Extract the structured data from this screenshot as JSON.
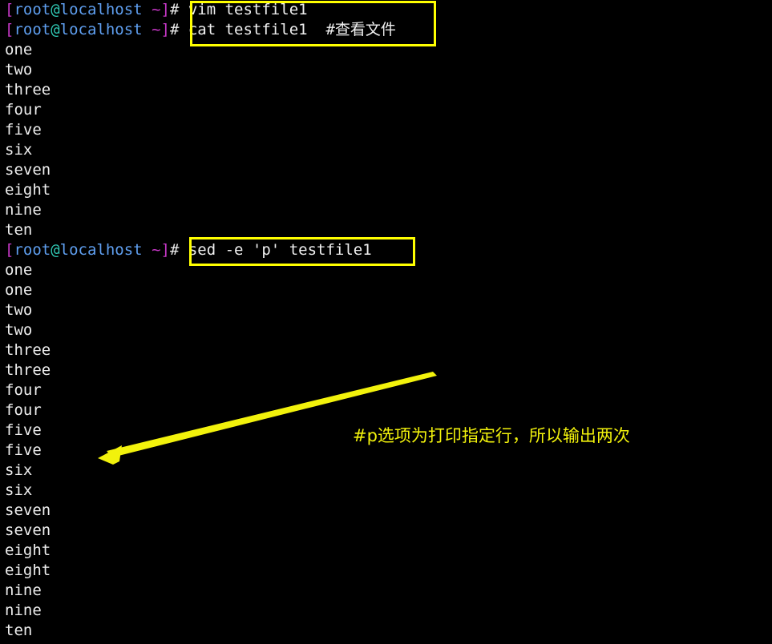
{
  "terminal": {
    "prompt": {
      "open_bracket": "[",
      "user": "root",
      "at": "@",
      "host": "localhost",
      "space_tilde": " ~",
      "close_bracket": "]",
      "hash": "#"
    },
    "colors": {
      "background": "#000000",
      "foreground": "#e8e8e8",
      "bracket": "#c838c8",
      "user": "#5f9ff0",
      "at": "#2fc4b0",
      "host": "#5f9ff0",
      "highlight_box": "#ffff00",
      "annotation": "#f2f20c",
      "arrow": "#f2f20c"
    },
    "commands": {
      "cmd1": "vim testfile1",
      "cmd2": "cat testfile1  #查看文件",
      "cmd3": "sed -e 'p' testfile1"
    },
    "output_cat": [
      "one",
      "two",
      "three",
      "four",
      "five",
      "six",
      "seven",
      "eight",
      "nine",
      "ten"
    ],
    "output_sed": [
      "one",
      "one",
      "two",
      "two",
      "three",
      "three",
      "four",
      "four",
      "five",
      "five",
      "six",
      "six",
      "seven",
      "seven",
      "eight",
      "eight",
      "nine",
      "nine",
      "ten"
    ]
  },
  "annotation": {
    "text": "#p选项为打印指定行，所以输出两次"
  }
}
